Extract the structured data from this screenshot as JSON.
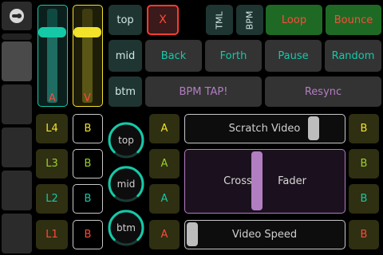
{
  "colors": {
    "teal": "#15c9a8",
    "yellow": "#f2e22a",
    "red": "#ff4a3a",
    "green": "#9bd12a",
    "pink": "#b27ec2",
    "loop_bg": "#1e6a24",
    "outline": "#c9c9c9"
  },
  "faders": {
    "audio": {
      "label": "A",
      "level": 0.78
    },
    "video": {
      "label": "V",
      "level": 0.78
    }
  },
  "position_buttons": {
    "top": "top",
    "mid": "mid",
    "btm": "btm"
  },
  "top_buttons": {
    "x": "X",
    "tml": "TML",
    "bpm": "BPM",
    "loop": "Loop",
    "bounce": "Bounce"
  },
  "nav_buttons": {
    "back": "Back",
    "forth": "Forth",
    "pause": "Pause",
    "random": "Random"
  },
  "tempo_buttons": {
    "bpm_tap": "BPM TAP!",
    "resync": "Resync"
  },
  "layers": [
    {
      "label": "L4",
      "b": "B"
    },
    {
      "label": "L3",
      "b": "B"
    },
    {
      "label": "L2",
      "b": "B"
    },
    {
      "label": "L1",
      "b": "B"
    }
  ],
  "knobs": {
    "top": "top",
    "mid": "mid",
    "btm": "btm"
  },
  "ab_labels": {
    "a_yellow": "A",
    "a_green": "A",
    "a_teal": "A",
    "a_red": "A",
    "b_yellow": "B",
    "b_green": "B",
    "b_teal": "B",
    "b_red": "B"
  },
  "sliders": {
    "scratch": {
      "label": "Scratch Video",
      "value": 0.84
    },
    "crossfader": {
      "label_left": "Cross",
      "label_right": "Fader",
      "value": 0.45
    },
    "video_speed": {
      "label": "Video Speed",
      "value": 0.0
    }
  }
}
